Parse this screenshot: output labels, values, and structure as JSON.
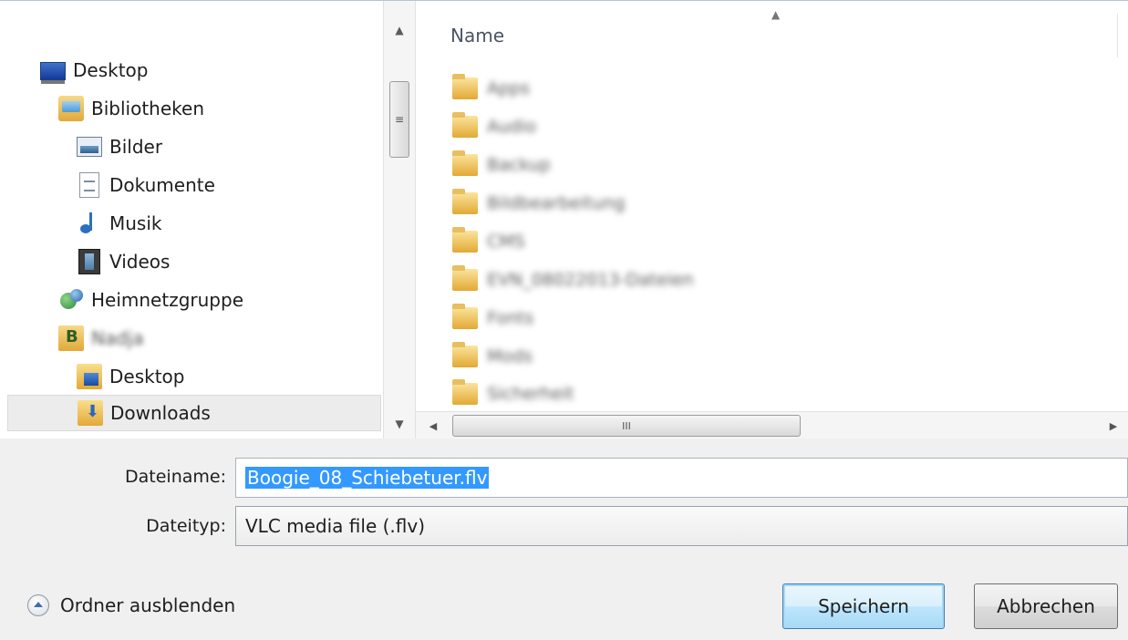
{
  "nav": {
    "items": [
      {
        "label": "Desktop",
        "icon": "desktop-icon"
      },
      {
        "label": "Bibliotheken",
        "icon": "libraries-icon"
      },
      {
        "label": "Bilder",
        "icon": "pictures-icon"
      },
      {
        "label": "Dokumente",
        "icon": "documents-icon"
      },
      {
        "label": "Musik",
        "icon": "music-icon"
      },
      {
        "label": "Videos",
        "icon": "videos-icon"
      },
      {
        "label": "Heimnetzgruppe",
        "icon": "homegroup-icon"
      },
      {
        "label": "Nadja",
        "icon": "user-folder-icon"
      },
      {
        "label": "Desktop",
        "icon": "desktop-folder-icon"
      },
      {
        "label": "Downloads",
        "icon": "downloads-folder-icon"
      }
    ]
  },
  "file_list": {
    "column_name": "Name",
    "folders": [
      "Apps",
      "Audio",
      "Backup",
      "Bildbearbeitung",
      "CMS",
      "EVN_08022013-Dateien",
      "Fonts",
      "Mods",
      "Sicherheit"
    ]
  },
  "scrollbar": {
    "grip": "≡",
    "hgrip": "III"
  },
  "form": {
    "filename_label": "Dateiname:",
    "filename_value": "Boogie_08_Schiebetuer.flv",
    "filetype_label": "Dateityp:",
    "filetype_value": "VLC media file (.flv)"
  },
  "footer": {
    "hide_folders_label": "Ordner ausblenden",
    "save_label": "Speichern",
    "cancel_label": "Abbrechen"
  }
}
